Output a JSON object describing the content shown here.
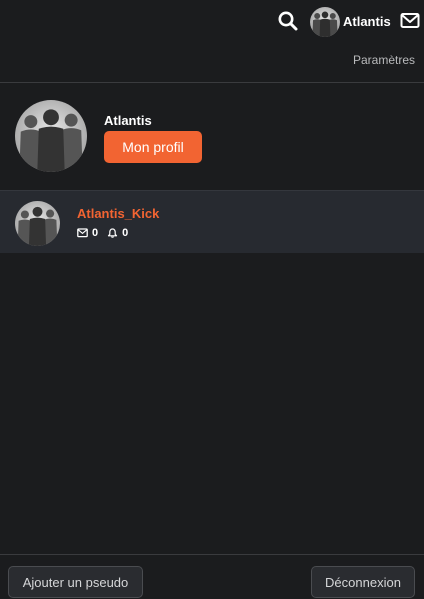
{
  "header": {
    "search_icon": "search-icon",
    "username": "Atlantis",
    "mail_icon": "mail-icon",
    "avatar_icon": "group-silhouette-avatar"
  },
  "settings": {
    "label": "Paramètres"
  },
  "profile": {
    "name": "Atlantis",
    "button_label": "Mon profil",
    "avatar_icon": "group-silhouette-avatar"
  },
  "accounts": [
    {
      "name": "Atlantis_Kick",
      "messages": "0",
      "notifications": "0",
      "message_icon": "envelope-icon",
      "notification_icon": "bell-icon"
    }
  ],
  "footer": {
    "add_pseudo_label": "Ajouter un pseudo",
    "logout_label": "Déconnexion"
  },
  "colors": {
    "background": "#1b1c1e",
    "accent": "#f26432",
    "row_highlight": "#272a30",
    "muted_text": "#b9babc"
  }
}
